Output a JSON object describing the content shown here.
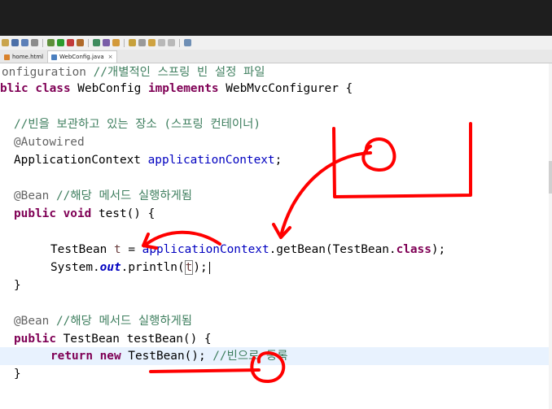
{
  "tabs": [
    {
      "label": "home.html",
      "active": false
    },
    {
      "label": "WebConfig.java",
      "active": true,
      "close": "×"
    }
  ],
  "code": {
    "l1": {
      "kw": "onfiguration",
      "cmt": "//개별적인 스프링 빈 설정 파일"
    },
    "l2": {
      "kw1": "blic class",
      "name": " WebConfig ",
      "kw2": "implements",
      "rest": " WebMvcConfigurer {"
    },
    "l3": {
      "cmt": "//빈을 보관하고 있는 장소 (스프링 컨테이너)"
    },
    "l4": {
      "ann": "@Autowired"
    },
    "l5": {
      "type": "ApplicationContext ",
      "fld": "applicationContext",
      "end": ";"
    },
    "l6": {
      "ann": "@Bean",
      "cmt": "//해당 메서드 실행하게됨"
    },
    "l7": {
      "kw": "public void",
      "rest": " test() {"
    },
    "l8": {
      "type": "TestBean ",
      "var": "t",
      "eq": " = ",
      "fld": "applicationContext",
      "mid": ".getBean(TestBean.",
      "kw": "class",
      "end": ");"
    },
    "l9": {
      "pre": "System.",
      "static": "out",
      "mid": ".println(",
      "var": "t",
      "end": ");"
    },
    "l10": {
      "brace": "}"
    },
    "l11": {
      "ann": "@Bean",
      "cmt": "//해당 메서드 실행하게됨"
    },
    "l12": {
      "kw": "public",
      "rest": " TestBean testBean() {"
    },
    "l13": {
      "kw": "return new",
      "rest": " TestBean();",
      "cmt": " //빈으로 등록"
    },
    "l14": {
      "brace": "}"
    }
  },
  "colors": {
    "keyword": "#7f0055",
    "annotation": "#646464",
    "comment": "#3f7f5f",
    "field": "#0000c0",
    "annotation_ink": "#ff0000"
  }
}
